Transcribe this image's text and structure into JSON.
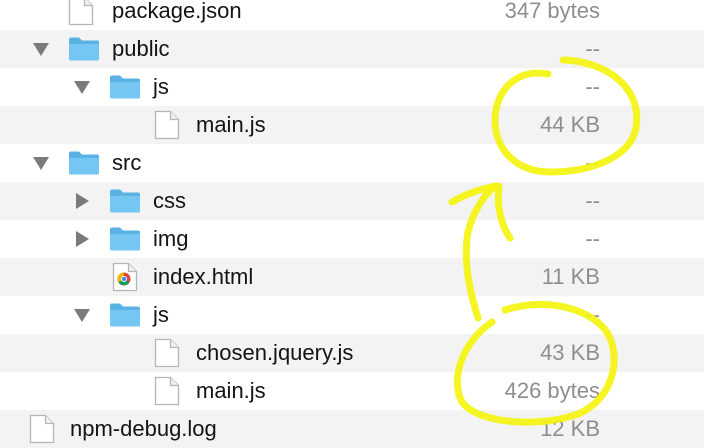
{
  "files": [
    {
      "name": "package.json",
      "size": "347 bytes",
      "icon": "file-icon",
      "toggle": "none"
    },
    {
      "name": "public",
      "size": "--",
      "icon": "folder-icon",
      "toggle": "expanded"
    },
    {
      "name": "js",
      "size": "--",
      "icon": "folder-icon",
      "toggle": "expanded"
    },
    {
      "name": "main.js",
      "size": "44 KB",
      "icon": "file-icon",
      "toggle": "none"
    },
    {
      "name": "src",
      "size": "--",
      "icon": "folder-icon",
      "toggle": "expanded"
    },
    {
      "name": "css",
      "size": "--",
      "icon": "folder-icon",
      "toggle": "collapsed"
    },
    {
      "name": "img",
      "size": "--",
      "icon": "folder-icon",
      "toggle": "collapsed"
    },
    {
      "name": "index.html",
      "size": "11 KB",
      "icon": "chrome-html-file-icon",
      "toggle": "none"
    },
    {
      "name": "js",
      "size": "--",
      "icon": "folder-icon",
      "toggle": "expanded"
    },
    {
      "name": "chosen.jquery.js",
      "size": "43 KB",
      "icon": "file-icon",
      "toggle": "none"
    },
    {
      "name": "main.js",
      "size": "426 bytes",
      "icon": "file-icon",
      "toggle": "none"
    },
    {
      "name": "npm-debug.log",
      "size": "12 KB",
      "icon": "file-icon",
      "toggle": "none"
    }
  ],
  "colors": {
    "folder": "#6fc0ee",
    "highlight": "#f4f410",
    "size_text": "#8e8e8e",
    "alt_row": "#f3f3f3"
  }
}
